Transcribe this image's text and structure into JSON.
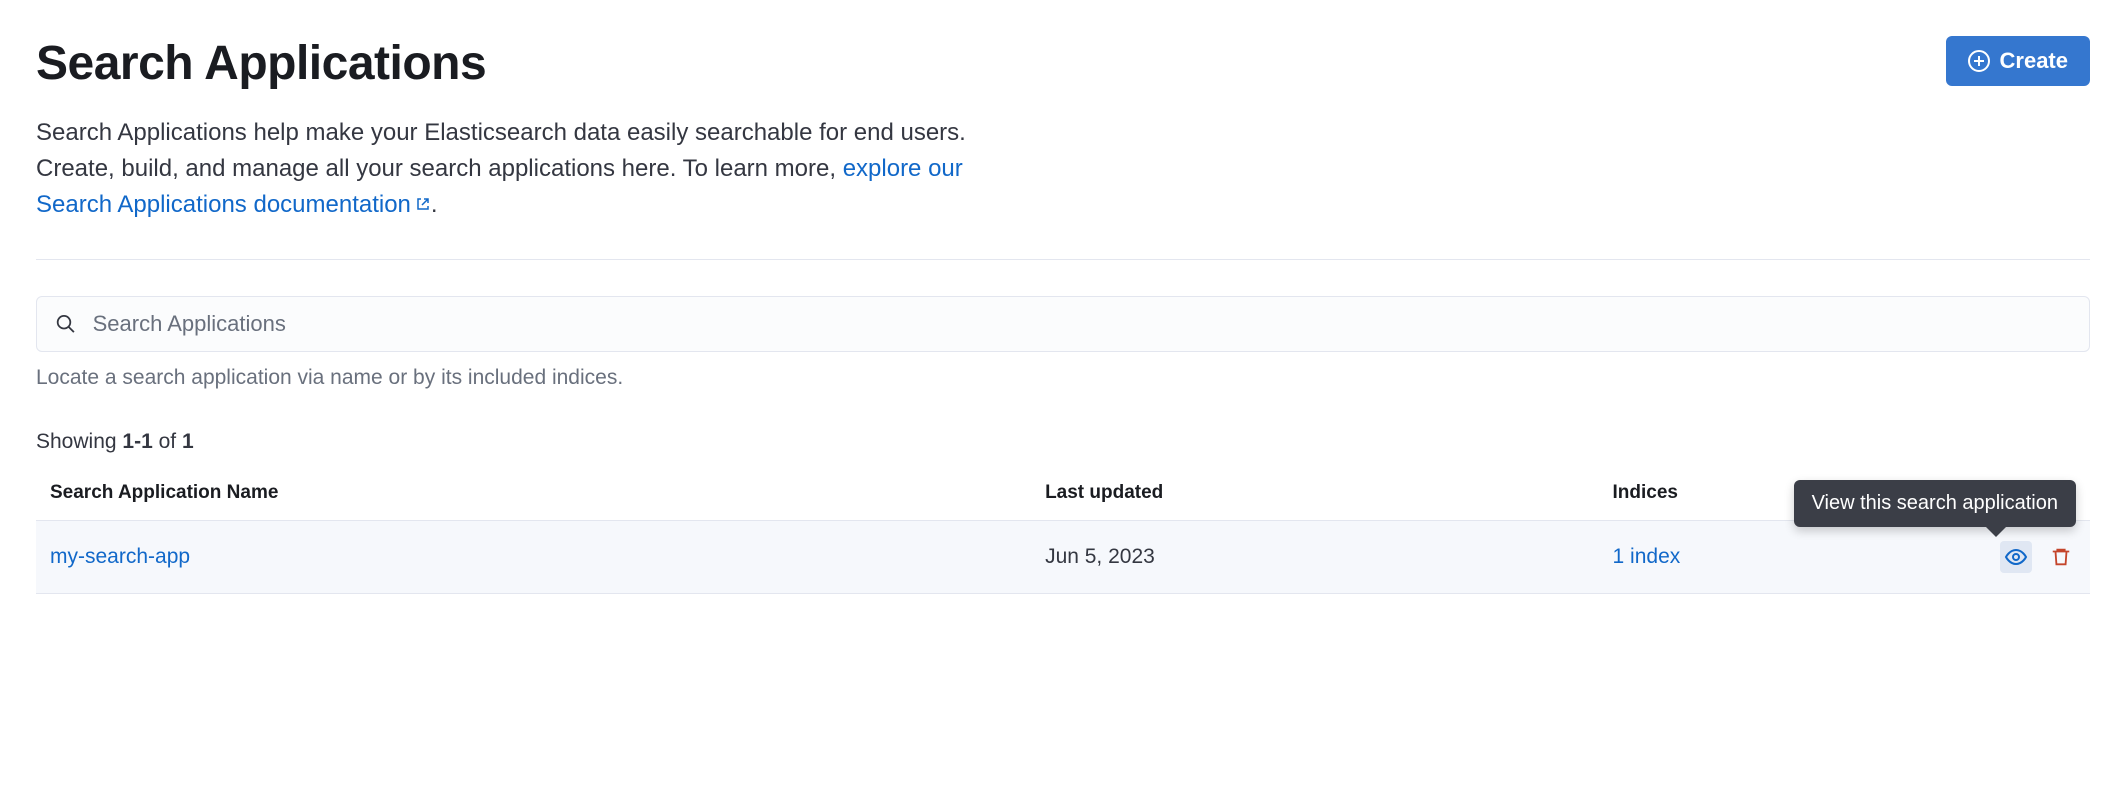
{
  "header": {
    "title": "Search Applications",
    "create_label": "Create"
  },
  "description": {
    "text_before_link": "Search Applications help make your Elasticsearch data easily searchable for end users. Create, build, and manage all your search applications here. To learn more, ",
    "link_text": "explore our Search Applications documentation",
    "text_after_link": "."
  },
  "search": {
    "placeholder": "Search Applications",
    "help_text": "Locate a search application via name or by its included indices."
  },
  "results": {
    "showing_prefix": "Showing ",
    "range": "1-1",
    "showing_middle": " of ",
    "total": "1"
  },
  "table": {
    "columns": {
      "name": "Search Application Name",
      "last_updated": "Last updated",
      "indices": "Indices"
    },
    "rows": [
      {
        "name": "my-search-app",
        "last_updated": "Jun 5, 2023",
        "indices": "1 index"
      }
    ]
  },
  "tooltip": {
    "view": "View this search application"
  }
}
